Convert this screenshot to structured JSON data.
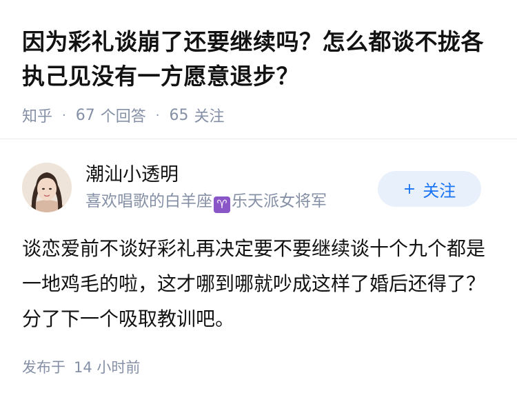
{
  "question": {
    "title": "因为彩礼谈崩了还要继续吗？怎么都谈不拢各执己见没有一方愿意退步？",
    "source": "知乎",
    "answer_count": "67",
    "answer_label": "个回答",
    "follow_count": "65",
    "follow_label": "关注"
  },
  "answer": {
    "author": {
      "name": "潮汕小透明",
      "bio_prefix": "喜欢唱歌的白羊座",
      "bio_badge": "♈",
      "bio_suffix": "乐天派女将军"
    },
    "follow_button": {
      "icon": "+",
      "label": "关注"
    },
    "content": "谈恋爱前不谈好彩礼再决定要不要继续谈十个九个都是一地鸡毛的啦，这才哪到哪就吵成这样了婚后还得了？分了下一个吸取教训吧。",
    "publish_label": "发布于",
    "publish_time": "14 小时前"
  },
  "colors": {
    "text": "#121212",
    "meta": "#8590a6",
    "accent": "#1772f6",
    "follow_bg": "#e8f0fb",
    "aries_badge": "#8a55c7"
  }
}
